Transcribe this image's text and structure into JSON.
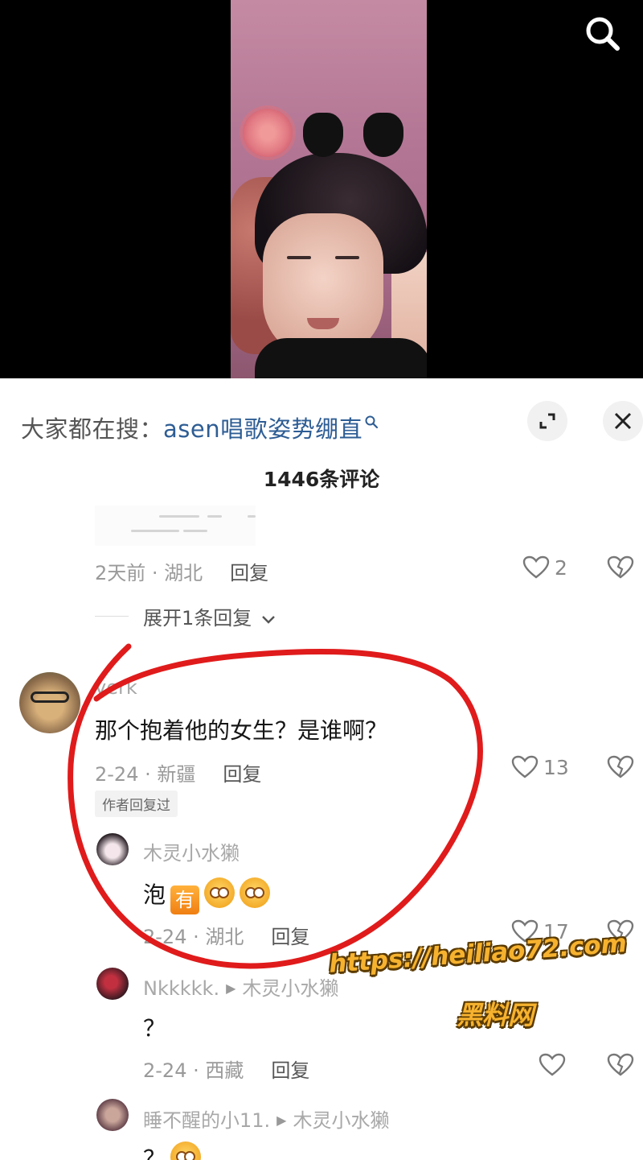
{
  "search_bar": {
    "prefix": "大家都在搜：",
    "keyword": "asen唱歌姿势绷直"
  },
  "comments_count": "1446条评论",
  "previous_comment": {
    "meta": "2天前 · 湖北",
    "reply_label": "回复",
    "likes": "2",
    "expand_label": "展开1条回复"
  },
  "comment": {
    "username": "verk",
    "text": "那个抱着他的女生？是谁啊？",
    "meta": "2-24 · 新疆",
    "reply_label": "回复",
    "likes": "13",
    "author_tag": "作者回复过"
  },
  "replies": [
    {
      "username": "木灵小水獭",
      "text": "泡",
      "emoji_badge": "有",
      "meta": "2-24 · 湖北",
      "reply_label": "回复",
      "likes": "17"
    },
    {
      "username": "Nkkkkk.",
      "reply_to": "木灵小水獭",
      "text": "？",
      "meta": "2-24 · 西藏",
      "reply_label": "回复",
      "likes": ""
    },
    {
      "username": "睡不醒的小11.",
      "reply_to": "木灵小水獭",
      "text": "？"
    }
  ],
  "watermark": {
    "url": "https://heiliao72.com",
    "name": "黑料网"
  },
  "colors": {
    "keyword": "#2e5d94",
    "annotation_circle": "#e01b1b",
    "watermark": "#f6b22f"
  },
  "icons": [
    "search-icon",
    "expand-icon",
    "close-icon",
    "heart-icon",
    "broken-heart-icon",
    "chevron-down-icon"
  ]
}
